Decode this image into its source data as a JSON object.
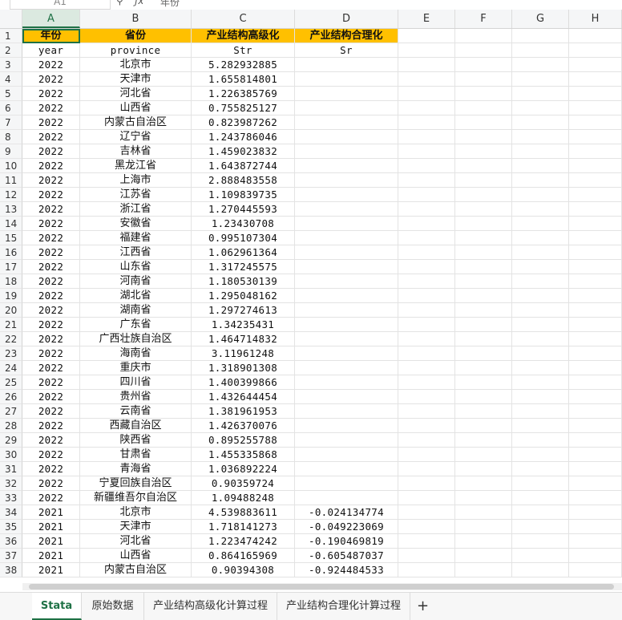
{
  "formula_bar": {
    "name_box": "A1",
    "formula": "年份"
  },
  "columns": [
    "A",
    "B",
    "C",
    "D",
    "E",
    "F",
    "G",
    "H"
  ],
  "header_row_1": [
    "年份",
    "省份",
    "产业结构高级化",
    "产业结构合理化"
  ],
  "header_row_2": [
    "year",
    "province",
    "Str",
    "Sr"
  ],
  "rows": [
    [
      "2022",
      "北京市",
      "5.282932885",
      ""
    ],
    [
      "2022",
      "天津市",
      "1.655814801",
      ""
    ],
    [
      "2022",
      "河北省",
      "1.226385769",
      ""
    ],
    [
      "2022",
      "山西省",
      "0.755825127",
      ""
    ],
    [
      "2022",
      "内蒙古自治区",
      "0.823987262",
      ""
    ],
    [
      "2022",
      "辽宁省",
      "1.243786046",
      ""
    ],
    [
      "2022",
      "吉林省",
      "1.459023832",
      ""
    ],
    [
      "2022",
      "黑龙江省",
      "1.643872744",
      ""
    ],
    [
      "2022",
      "上海市",
      "2.888483558",
      ""
    ],
    [
      "2022",
      "江苏省",
      "1.109839735",
      ""
    ],
    [
      "2022",
      "浙江省",
      "1.270445593",
      ""
    ],
    [
      "2022",
      "安徽省",
      "1.23430708",
      ""
    ],
    [
      "2022",
      "福建省",
      "0.995107304",
      ""
    ],
    [
      "2022",
      "江西省",
      "1.062961364",
      ""
    ],
    [
      "2022",
      "山东省",
      "1.317245575",
      ""
    ],
    [
      "2022",
      "河南省",
      "1.180530139",
      ""
    ],
    [
      "2022",
      "湖北省",
      "1.295048162",
      ""
    ],
    [
      "2022",
      "湖南省",
      "1.297274613",
      ""
    ],
    [
      "2022",
      "广东省",
      "1.34235431",
      ""
    ],
    [
      "2022",
      "广西壮族自治区",
      "1.464714832",
      ""
    ],
    [
      "2022",
      "海南省",
      "3.11961248",
      ""
    ],
    [
      "2022",
      "重庆市",
      "1.318901308",
      ""
    ],
    [
      "2022",
      "四川省",
      "1.400399866",
      ""
    ],
    [
      "2022",
      "贵州省",
      "1.432644454",
      ""
    ],
    [
      "2022",
      "云南省",
      "1.381961953",
      ""
    ],
    [
      "2022",
      "西藏自治区",
      "1.426370076",
      ""
    ],
    [
      "2022",
      "陕西省",
      "0.895255788",
      ""
    ],
    [
      "2022",
      "甘肃省",
      "1.455335868",
      ""
    ],
    [
      "2022",
      "青海省",
      "1.036892224",
      ""
    ],
    [
      "2022",
      "宁夏回族自治区",
      "0.90359724",
      ""
    ],
    [
      "2022",
      "新疆维吾尔自治区",
      "1.09488248",
      ""
    ],
    [
      "2021",
      "北京市",
      "4.539883611",
      "-0.024134774"
    ],
    [
      "2021",
      "天津市",
      "1.718141273",
      "-0.049223069"
    ],
    [
      "2021",
      "河北省",
      "1.223474242",
      "-0.190469819"
    ],
    [
      "2021",
      "山西省",
      "0.864165969",
      "-0.605487037"
    ],
    [
      "2021",
      "内蒙古自治区",
      "0.90394308",
      "-0.924484533"
    ]
  ],
  "tabs": [
    "Stata",
    "原始数据",
    "产业结构高级化计算过程",
    "产业结构合理化计算过程"
  ],
  "add_tab": "+",
  "colors": {
    "accent": "#1e7145",
    "header_fill": "#ffc000"
  }
}
